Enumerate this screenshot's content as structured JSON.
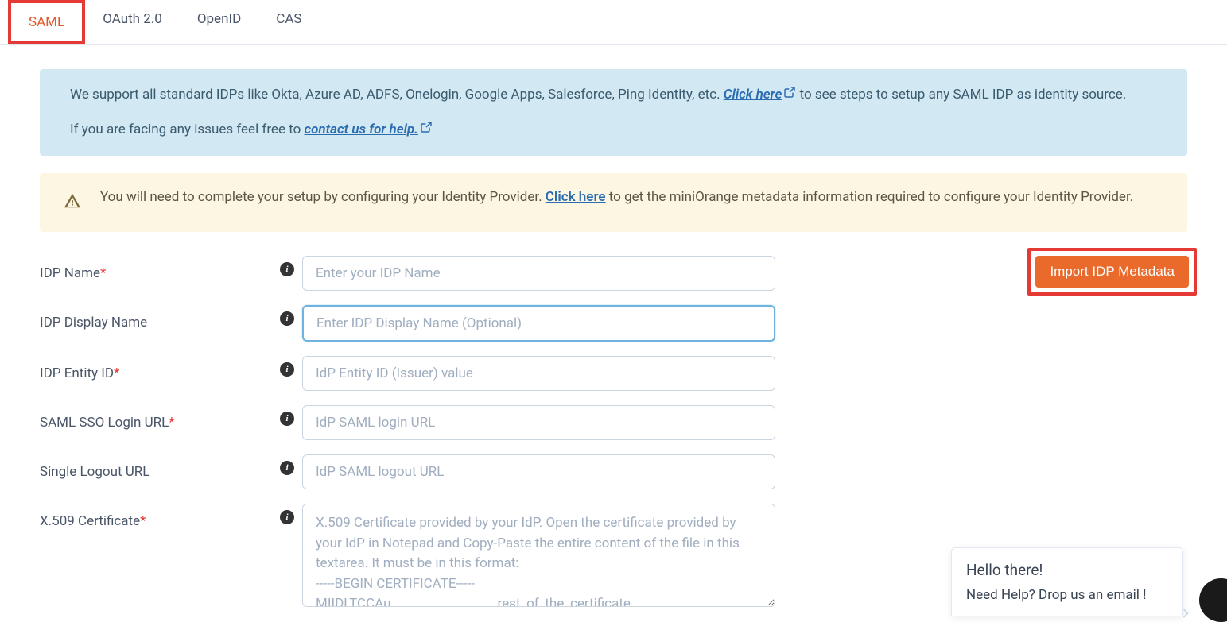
{
  "tabs": {
    "saml": "SAML",
    "oauth": "OAuth 2.0",
    "openid": "OpenID",
    "cas": "CAS"
  },
  "info_box": {
    "line1_pre": "We support all standard IDPs like Okta, Azure AD, ADFS, Onelogin, Google Apps, Salesforce, Ping Identity, etc. ",
    "click_here": "Click here",
    "line1_post": " to see steps to setup any SAML IDP as identity source.",
    "line2_pre": "If you are facing any issues feel free to ",
    "contact_us": "contact us for help."
  },
  "warn_box": {
    "text_pre": "You will need to complete your setup by configuring your Identity Provider. ",
    "click_here": "Click here",
    "text_post": " to get the miniOrange metadata information required to configure your Identity Provider."
  },
  "import_btn": "Import IDP Metadata",
  "form": {
    "idp_name": {
      "label": "IDP Name",
      "placeholder": "Enter your IDP Name"
    },
    "idp_display_name": {
      "label": "IDP Display Name",
      "placeholder": "Enter IDP Display Name (Optional)"
    },
    "idp_entity_id": {
      "label": "IDP Entity ID",
      "placeholder": "IdP Entity ID (Issuer) value"
    },
    "saml_sso_url": {
      "label": "SAML SSO Login URL",
      "placeholder": "IdP SAML login URL"
    },
    "slo_url": {
      "label": "Single Logout URL",
      "placeholder": "IdP SAML logout URL"
    },
    "x509": {
      "label": "X.509 Certificate",
      "placeholder": "X.509 Certificate provided by your IdP. Open the certificate provided by your IdP in Notepad and Copy-Paste the entire content of the file in this textarea. It must be in this format:\n-----BEGIN CERTIFICATE-----\nMIIDLTCCAu ............................ rest_of_the_certificate ............................"
    }
  },
  "chat": {
    "hello": "Hello there!",
    "msg": "Need Help? Drop us an email !"
  }
}
